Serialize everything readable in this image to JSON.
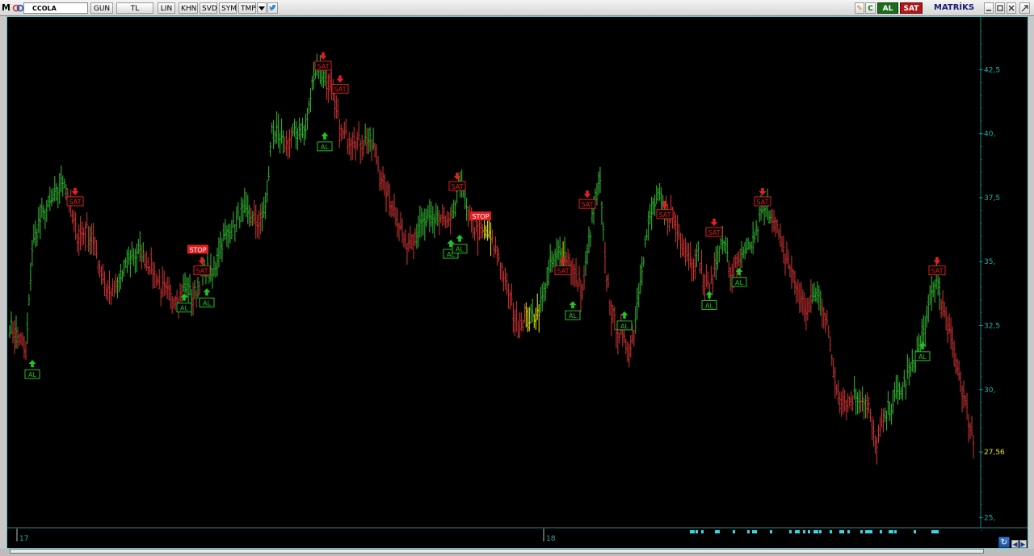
{
  "toolbar": {
    "app_logo": "M",
    "symbol": "CCOLA",
    "period": "GUN",
    "currency": "TL",
    "scale": "LIN",
    "khn": "KHN",
    "svd": "SVD",
    "sym": "SYM",
    "tmp": "TMP",
    "dropdown_icon": "chevron-down-icon",
    "twitter_icon": "twitter-icon",
    "buy_button": "AL",
    "sell_button": "SAT",
    "brand": "MATRİKS",
    "colors": {
      "buy": "#1d6b1d",
      "sell": "#b01818"
    }
  },
  "chart_data": {
    "type": "bar",
    "subtype": "ohlc",
    "symbol": "CCOLA",
    "y_ticks": [
      "25,",
      "27,56",
      "30,",
      "32,5",
      "35,",
      "37,5",
      "40,",
      "42,5"
    ],
    "last_price": "27,56",
    "x_ticks": [
      "17",
      "18"
    ],
    "ylim": [
      24,
      44.5
    ],
    "grid": false,
    "series_colors": {
      "rising": "#2eaa2e",
      "falling": "#c03030",
      "neutral": "#d8d800",
      "axis_text": "#1fb0b0",
      "last_price_text": "#e6e600"
    },
    "anchors": [
      [
        0,
        32.5
      ],
      [
        8,
        31.8
      ],
      [
        10,
        31.2
      ],
      [
        14,
        35.5
      ],
      [
        18,
        36.5
      ],
      [
        28,
        37.5
      ],
      [
        34,
        38.3
      ],
      [
        38,
        37.0
      ],
      [
        42,
        36.0
      ],
      [
        48,
        36.2
      ],
      [
        52,
        35.8
      ],
      [
        56,
        34.8
      ],
      [
        60,
        34.0
      ],
      [
        64,
        33.8
      ],
      [
        70,
        34.5
      ],
      [
        76,
        35.2
      ],
      [
        82,
        35.3
      ],
      [
        88,
        34.8
      ],
      [
        94,
        34.0
      ],
      [
        100,
        33.6
      ],
      [
        106,
        33.7
      ],
      [
        110,
        34.0
      ],
      [
        114,
        33.6
      ],
      [
        118,
        34.2
      ],
      [
        122,
        34.8
      ],
      [
        126,
        34.3
      ],
      [
        130,
        35.5
      ],
      [
        134,
        36.0
      ],
      [
        140,
        36.4
      ],
      [
        144,
        37.0
      ],
      [
        150,
        36.7
      ],
      [
        156,
        36.5
      ],
      [
        160,
        37.5
      ],
      [
        163,
        40.3
      ],
      [
        168,
        39.7
      ],
      [
        172,
        39.6
      ],
      [
        176,
        39.9
      ],
      [
        180,
        40.2
      ],
      [
        184,
        40.1
      ],
      [
        186,
        41.0
      ],
      [
        189,
        42.4
      ],
      [
        192,
        42.6
      ],
      [
        195,
        42.2
      ],
      [
        199,
        41.9
      ],
      [
        202,
        41.0
      ],
      [
        206,
        40.0
      ],
      [
        210,
        39.8
      ],
      [
        214,
        39.9
      ],
      [
        218,
        39.6
      ],
      [
        222,
        39.8
      ],
      [
        226,
        39.5
      ],
      [
        230,
        38.5
      ],
      [
        234,
        37.8
      ],
      [
        238,
        37.2
      ],
      [
        242,
        36.5
      ],
      [
        246,
        35.7
      ],
      [
        250,
        36.0
      ],
      [
        254,
        36.3
      ],
      [
        258,
        36.5
      ],
      [
        262,
        36.6
      ],
      [
        266,
        36.8
      ],
      [
        270,
        36.5
      ],
      [
        274,
        36.4
      ],
      [
        278,
        37.5
      ],
      [
        281,
        38.3
      ],
      [
        284,
        37.0
      ],
      [
        288,
        36.3
      ],
      [
        292,
        36.1
      ],
      [
        296,
        36.2
      ],
      [
        300,
        35.7
      ],
      [
        304,
        35.2
      ],
      [
        308,
        34.3
      ],
      [
        312,
        33.3
      ],
      [
        316,
        32.5
      ],
      [
        320,
        32.8
      ],
      [
        324,
        32.8
      ],
      [
        328,
        33.0
      ],
      [
        332,
        33.8
      ],
      [
        336,
        34.8
      ],
      [
        340,
        35.2
      ],
      [
        344,
        35.4
      ],
      [
        348,
        35.0
      ],
      [
        352,
        34.3
      ],
      [
        356,
        33.8
      ],
      [
        360,
        35.8
      ],
      [
        364,
        37.5
      ],
      [
        367,
        38.0
      ],
      [
        370,
        35.0
      ],
      [
        374,
        33.0
      ],
      [
        378,
        32.3
      ],
      [
        382,
        31.8
      ],
      [
        386,
        31.6
      ],
      [
        388,
        32.3
      ],
      [
        392,
        34.5
      ],
      [
        396,
        36.0
      ],
      [
        400,
        37.2
      ],
      [
        404,
        37.5
      ],
      [
        408,
        36.8
      ],
      [
        412,
        36.8
      ],
      [
        416,
        36.0
      ],
      [
        420,
        35.5
      ],
      [
        424,
        35.0
      ],
      [
        428,
        35.3
      ],
      [
        432,
        34.0
      ],
      [
        436,
        34.0
      ],
      [
        440,
        35.3
      ],
      [
        444,
        35.8
      ],
      [
        448,
        34.5
      ],
      [
        452,
        34.8
      ],
      [
        456,
        35.2
      ],
      [
        460,
        35.5
      ],
      [
        464,
        36.2
      ],
      [
        468,
        37.1
      ],
      [
        472,
        37.0
      ],
      [
        476,
        36.5
      ],
      [
        480,
        35.5
      ],
      [
        484,
        35.0
      ],
      [
        488,
        34.2
      ],
      [
        492,
        33.5
      ],
      [
        496,
        33.0
      ],
      [
        500,
        33.8
      ],
      [
        504,
        33.5
      ],
      [
        508,
        32.8
      ],
      [
        510,
        31.5
      ],
      [
        514,
        30.0
      ],
      [
        518,
        29.6
      ],
      [
        522,
        29.6
      ],
      [
        526,
        29.8
      ],
      [
        530,
        29.7
      ],
      [
        534,
        29.3
      ],
      [
        536,
        28.5
      ],
      [
        538,
        27.8
      ],
      [
        542,
        28.5
      ],
      [
        546,
        29.2
      ],
      [
        550,
        29.6
      ],
      [
        554,
        30.0
      ],
      [
        558,
        30.5
      ],
      [
        562,
        31.0
      ],
      [
        566,
        31.8
      ],
      [
        570,
        32.7
      ],
      [
        574,
        34.0
      ],
      [
        576,
        34.5
      ],
      [
        578,
        33.8
      ],
      [
        580,
        33.2
      ],
      [
        584,
        32.2
      ],
      [
        588,
        31.3
      ],
      [
        592,
        30.0
      ],
      [
        596,
        28.8
      ],
      [
        600,
        27.7
      ]
    ],
    "signals": [
      {
        "type": "AL",
        "price": 31.0
      },
      {
        "type": "SAT",
        "price": 37.5
      },
      {
        "type": "AL",
        "price": 33.6
      },
      {
        "type": "AL",
        "price": 33.8
      },
      {
        "type": "STOP",
        "price": 35.5
      },
      {
        "type": "SAT",
        "price": 34.8
      },
      {
        "type": "AL",
        "price": 39.9
      },
      {
        "type": "SAT",
        "price": 42.8
      },
      {
        "type": "SAT",
        "price": 41.9
      },
      {
        "type": "SAT",
        "price": 38.1
      },
      {
        "type": "AL",
        "price": 35.7
      },
      {
        "type": "AL",
        "price": 35.9
      },
      {
        "type": "STOP",
        "price": 36.8
      },
      {
        "type": "SAT",
        "price": 34.8
      },
      {
        "type": "AL",
        "price": 33.3
      },
      {
        "type": "SAT",
        "price": 37.4
      },
      {
        "type": "AL",
        "price": 32.9
      },
      {
        "type": "SAT",
        "price": 37.0
      },
      {
        "type": "SAT",
        "price": 36.3
      },
      {
        "type": "AL",
        "price": 33.7
      },
      {
        "type": "AL",
        "price": 34.6
      },
      {
        "type": "SAT",
        "price": 37.5
      },
      {
        "type": "AL",
        "price": 31.7
      },
      {
        "type": "SAT",
        "price": 34.8
      }
    ],
    "activity_marks": 26
  }
}
